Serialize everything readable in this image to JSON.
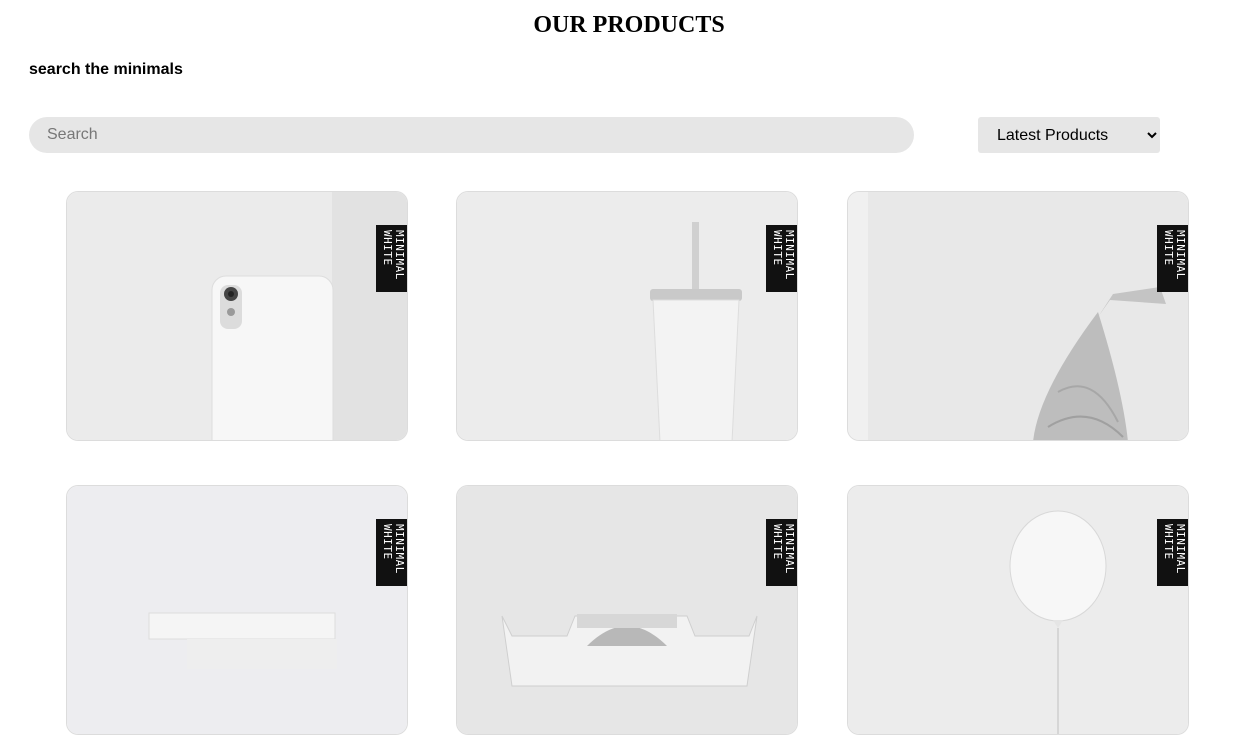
{
  "header": {
    "title": "OUR PRODUCTS",
    "subtitle": "search the minimals"
  },
  "search": {
    "placeholder": "Search"
  },
  "sort": {
    "selected": "Latest Products"
  },
  "brand": {
    "badge_line1": "MINIMAL",
    "badge_line2": "WHITE"
  },
  "products": [
    {
      "icon": "white-phone-image"
    },
    {
      "icon": "white-tumbler-image"
    },
    {
      "icon": "silver-kiss-image"
    },
    {
      "icon": "white-books-image"
    },
    {
      "icon": "white-typewriter-image"
    },
    {
      "icon": "white-balloon-image"
    }
  ]
}
